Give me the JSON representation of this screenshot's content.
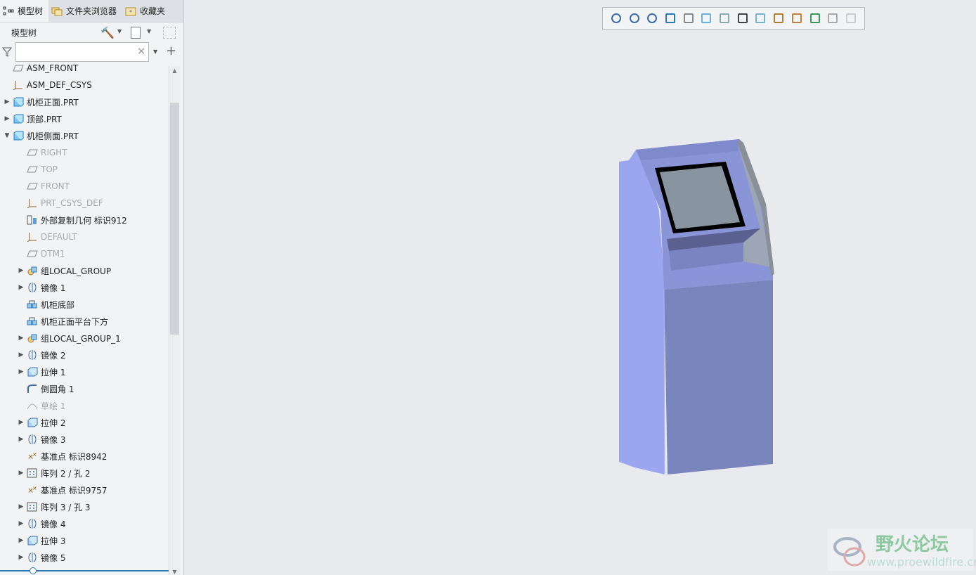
{
  "tabs": [
    {
      "label": "模型树"
    },
    {
      "label": "文件夹浏览器"
    },
    {
      "label": "收藏夹"
    }
  ],
  "panel": {
    "title": "模型树",
    "search_placeholder": "",
    "clear": "×",
    "add": "+"
  },
  "tree": [
    {
      "label": "ASM_FRONT",
      "level": 0,
      "exp": "",
      "icon": "plane",
      "dim": false
    },
    {
      "label": "ASM_DEF_CSYS",
      "level": 0,
      "exp": "",
      "icon": "csys",
      "dim": false
    },
    {
      "label": "机柜正面.PRT",
      "level": 0,
      "exp": "▶",
      "icon": "part",
      "dim": false
    },
    {
      "label": "顶部.PRT",
      "level": 0,
      "exp": "▶",
      "icon": "part",
      "dim": false
    },
    {
      "label": "机柜侧面.PRT",
      "level": 0,
      "exp": "▼",
      "icon": "part",
      "dim": false
    },
    {
      "label": "RIGHT",
      "level": 1,
      "exp": "",
      "icon": "plane",
      "dim": true
    },
    {
      "label": "TOP",
      "level": 1,
      "exp": "",
      "icon": "plane",
      "dim": true
    },
    {
      "label": "FRONT",
      "level": 1,
      "exp": "",
      "icon": "plane",
      "dim": true
    },
    {
      "label": "PRT_CSYS_DEF",
      "level": 1,
      "exp": "",
      "icon": "csys",
      "dim": true
    },
    {
      "label": "外部复制几何 标识912",
      "level": 1,
      "exp": "",
      "icon": "copygeom",
      "dim": false
    },
    {
      "label": "DEFAULT",
      "level": 1,
      "exp": "",
      "icon": "csys",
      "dim": true
    },
    {
      "label": "DTM1",
      "level": 1,
      "exp": "",
      "icon": "plane",
      "dim": true
    },
    {
      "label": "组LOCAL_GROUP",
      "level": 1,
      "exp": "▶",
      "icon": "group",
      "dim": false
    },
    {
      "label": "镜像 1",
      "level": 1,
      "exp": "▶",
      "icon": "mirror",
      "dim": false
    },
    {
      "label": "机柜底部",
      "level": 1,
      "exp": "",
      "icon": "udf",
      "dim": false
    },
    {
      "label": "机柜正面平台下方",
      "level": 1,
      "exp": "",
      "icon": "udf",
      "dim": false
    },
    {
      "label": "组LOCAL_GROUP_1",
      "level": 1,
      "exp": "▶",
      "icon": "group",
      "dim": false
    },
    {
      "label": "镜像 2",
      "level": 1,
      "exp": "▶",
      "icon": "mirror",
      "dim": false
    },
    {
      "label": "拉伸 1",
      "level": 1,
      "exp": "▶",
      "icon": "extrude",
      "dim": false
    },
    {
      "label": "倒圆角 1",
      "level": 1,
      "exp": "",
      "icon": "round",
      "dim": false
    },
    {
      "label": "草绘 1",
      "level": 1,
      "exp": "",
      "icon": "sketch",
      "dim": true
    },
    {
      "label": "拉伸 2",
      "level": 1,
      "exp": "▶",
      "icon": "extrude",
      "dim": false
    },
    {
      "label": "镜像 3",
      "level": 1,
      "exp": "▶",
      "icon": "mirror",
      "dim": false
    },
    {
      "label": "基准点 标识8942",
      "level": 1,
      "exp": "",
      "icon": "point",
      "dim": false
    },
    {
      "label": "阵列 2 / 孔 2",
      "level": 1,
      "exp": "▶",
      "icon": "pattern",
      "dim": false
    },
    {
      "label": "基准点 标识9757",
      "level": 1,
      "exp": "",
      "icon": "point",
      "dim": false
    },
    {
      "label": "阵列 3 / 孔 3",
      "level": 1,
      "exp": "▶",
      "icon": "pattern",
      "dim": false
    },
    {
      "label": "镜像 4",
      "level": 1,
      "exp": "▶",
      "icon": "mirror",
      "dim": false
    },
    {
      "label": "拉伸 3",
      "level": 1,
      "exp": "▶",
      "icon": "extrude",
      "dim": false
    },
    {
      "label": "镜像 5",
      "level": 1,
      "exp": "▶",
      "icon": "mirror",
      "dim": false
    }
  ],
  "toolbar": [
    "refit-icon",
    "zoom-in-icon",
    "zoom-out-icon",
    "repaint-icon",
    "display-style-icon",
    "saved-orientations-icon",
    "view-manager-icon",
    "perspective-icon",
    "spin-center-icon",
    "datum-display-icon",
    "annotation-display-icon",
    "appearance-icon",
    "section-icon",
    "render-icon"
  ],
  "watermark": {
    "title": "野火论坛",
    "url": "www.proewildfire.cn"
  },
  "colors": {
    "accent": "#2a7ab8",
    "model_side": "#9aa6f0",
    "model_front": "#7a84bd"
  }
}
